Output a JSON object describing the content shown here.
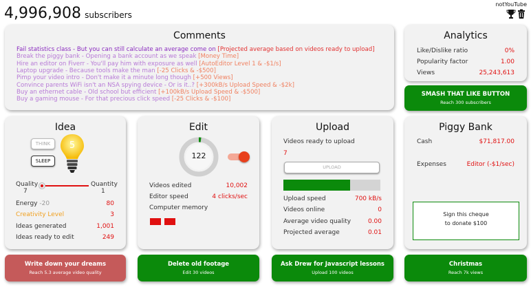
{
  "header": {
    "subscriber_count": "4,996,908",
    "subscriber_label": "subscribers",
    "channel_name": "notYouTube",
    "trophy_icon": "trophy-icon",
    "trash_icon": "trash-icon"
  },
  "comments": {
    "title": "Comments",
    "lines": [
      {
        "text": "Fail statistics class - But you can still calculate an average come on ",
        "cost": "[Projected average based on videos ready to upload]",
        "color": "#8a2bbf"
      },
      {
        "text": "Break the piggy bank - Opening a bank account as we speak ",
        "cost": "[Money Time]",
        "color": "#b77ad6"
      },
      {
        "text": "Hire an editor on Fiverr - You'll pay him with exposure as well ",
        "cost": "[AutoEditor Level 1 & -$1/s]",
        "color": "#b77ad6"
      },
      {
        "text": "Laptop upgrade - Because tools make the man ",
        "cost": "[-25 Clicks & -$500]",
        "color": "#b77ad6"
      },
      {
        "text": "Pimp your video intro - Don't make it a minute long though ",
        "cost": "[+500 Views]",
        "color": "#b77ad6"
      },
      {
        "text": "Convince parents WiFi isn't an NSA spying device - Or is it..? ",
        "cost": "[+300kB/s Upload Speed & -$2k]",
        "color": "#b77ad6"
      },
      {
        "text": "Buy an ethernet cable - Old school but efficient ",
        "cost": "[+100kB/s Upload Speed & -$500]",
        "color": "#b77ad6"
      },
      {
        "text": "Buy a gaming mouse - For that precious click speed ",
        "cost": "[-25 Clicks & -$100]",
        "color": "#b77ad6"
      }
    ]
  },
  "analytics": {
    "title": "Analytics",
    "rows": [
      {
        "label": "Like/Dislike ratio",
        "value": "0%"
      },
      {
        "label": "Popularity factor",
        "value": "1.00"
      },
      {
        "label": "Views",
        "value": "25,243,613"
      }
    ],
    "button": {
      "title": "SMASH THAT LIKE BUTTON",
      "sub": "Reach 300 subscribers"
    }
  },
  "idea": {
    "title": "Idea",
    "think_label": "THINK",
    "sleep_label": "SLEEP",
    "bulb_number": "5",
    "quality_label": "Quality",
    "quality_value": "7",
    "quantity_label": "Quantity",
    "quantity_value": "1",
    "slider_fraction": 0.0,
    "energy_label": "Energy",
    "energy_delta": "-20",
    "energy_value": "80",
    "creativity_label": "Creativity Level",
    "creativity_value": "3",
    "generated_label": "Ideas generated",
    "generated_value": "1,001",
    "ready_label": "Ideas ready to edit",
    "ready_value": "249",
    "button": {
      "title": "Write down your dreams",
      "sub": "Reach 5.3 average video quality"
    }
  },
  "edit": {
    "title": "Edit",
    "dial_value": "122",
    "dial_fraction": 0.02,
    "toggle_on": true,
    "rows": [
      {
        "label": "Videos edited",
        "value": "10,002"
      },
      {
        "label": "Editor speed",
        "value": "4 clicks/sec"
      },
      {
        "label": "Computer memory",
        "value": ""
      }
    ],
    "memory_blocks": 2,
    "button": {
      "title": "Delete old footage",
      "sub": "Edit 30 videos"
    }
  },
  "upload": {
    "title": "Upload",
    "ready_label": "Videos ready to upload",
    "ready_value": "7",
    "upload_button": "UPLOAD",
    "progress_fraction": 0.69,
    "rows": [
      {
        "label": "Upload speed",
        "value": "700 kB/s"
      },
      {
        "label": "Videos online",
        "value": "0"
      },
      {
        "label": "Average video quality",
        "value": "0.00"
      },
      {
        "label": "Projected average",
        "value": "0.01"
      }
    ],
    "button": {
      "title": "Ask Drew for Javascript lessons",
      "sub": "Upload 100 videos"
    }
  },
  "piggy": {
    "title": "Piggy Bank",
    "cash_label": "Cash",
    "cash_value": "$71,817.00",
    "expenses_label": "Expenses",
    "expenses_value": "Editor (-$1/sec)",
    "cheque_line1": "Sign this cheque",
    "cheque_line2": "to donate $100",
    "button": {
      "title": "Christmas",
      "sub": "Reach 7k views"
    }
  },
  "colors": {
    "accent_red": "#e01010",
    "green": "#0b8a0b",
    "dream_button": "#c55a5a",
    "creativity": "#f0a020",
    "energy_delta": "#999999"
  }
}
